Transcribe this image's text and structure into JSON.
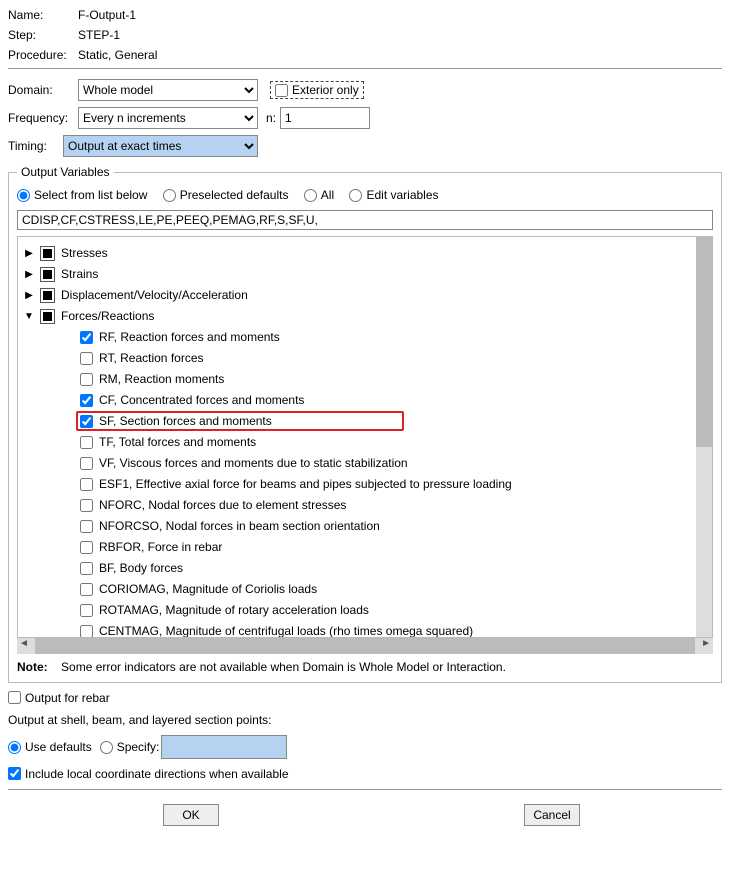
{
  "header": {
    "nameLabel": "Name:",
    "nameValue": "F-Output-1",
    "stepLabel": "Step:",
    "stepValue": "STEP-1",
    "procedureLabel": "Procedure:",
    "procedureValue": "Static, General"
  },
  "domainRow": {
    "label": "Domain:",
    "value": "Whole model",
    "exteriorOnly": "Exterior only"
  },
  "frequencyRow": {
    "label": "Frequency:",
    "value": "Every n increments",
    "nLabel": "n:",
    "nValue": "1"
  },
  "timingRow": {
    "label": "Timing:",
    "value": "Output at exact times"
  },
  "outputVariables": {
    "legend": "Output Variables",
    "radios": {
      "selectFromList": "Select from list below",
      "preselected": "Preselected defaults",
      "all": "All",
      "edit": "Edit variables"
    },
    "variablesString": "CDISP,CF,CSTRESS,LE,PE,PEEQ,PEMAG,RF,S,SF,U,",
    "categories": {
      "stresses": "Stresses",
      "strains": "Strains",
      "displacement": "Displacement/Velocity/Acceleration",
      "forces": "Forces/Reactions"
    },
    "forcesChildren": {
      "rf": "RF, Reaction forces and moments",
      "rt": "RT, Reaction forces",
      "rm": "RM, Reaction moments",
      "cf": "CF, Concentrated forces and moments",
      "sf": "SF, Section forces and moments",
      "tf": "TF, Total forces and moments",
      "vf": "VF, Viscous forces and moments due to static stabilization",
      "esf1": "ESF1, Effective axial force for beams and pipes subjected to pressure loading",
      "nforc": "NFORC, Nodal forces due to element stresses",
      "nforcso": "NFORCSO, Nodal forces in beam section orientation",
      "rbfor": "RBFOR, Force in rebar",
      "bf": "BF, Body forces",
      "coriomag": "CORIOMAG, Magnitude of Coriolis loads",
      "rotamag": "ROTAMAG, Magnitude of rotary acceleration loads",
      "centmag": "CENTMAG, Magnitude of centrifugal loads (rho times omega squared)"
    },
    "noteLabel": "Note:",
    "noteText": "Some error indicators are not available when Domain is Whole Model or Interaction."
  },
  "outputForRebar": "Output for rebar",
  "sectionPoints": {
    "title": "Output at shell, beam, and layered section points:",
    "useDefaults": "Use defaults",
    "specify": "Specify:"
  },
  "includeLocalCoord": "Include local coordinate directions when available",
  "buttons": {
    "ok": "OK",
    "cancel": "Cancel"
  }
}
